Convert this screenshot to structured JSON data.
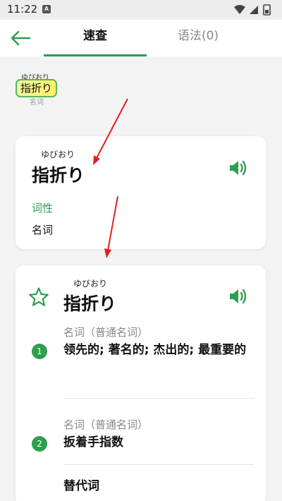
{
  "status_bar": {
    "time": "11:22",
    "notification_badge": "A"
  },
  "nav": {
    "back_icon": "arrow-left-icon",
    "tabs": [
      {
        "label": "速查",
        "active": true
      },
      {
        "label": "语法(0)",
        "active": false
      }
    ],
    "accent_color": "#2e9e4f"
  },
  "chip": {
    "ruby": "ゆびおり",
    "word": "指折り",
    "pos": "名词"
  },
  "summary_card": {
    "ruby": "ゆびおり",
    "word": "指折り",
    "part_of_speech_label": "词性",
    "part_of_speech": "名词",
    "speaker_icon": "speaker-icon"
  },
  "detail_card": {
    "ruby": "ゆびおり",
    "word": "指折り",
    "star_icon": "star-outline-icon",
    "speaker_icon": "speaker-icon",
    "senses": [
      {
        "number": "1",
        "pos": "名词（普通名词）",
        "definition": "领先的; 著名的; 杰出的; 最重要的"
      },
      {
        "number": "2",
        "pos": "名词（普通名词）",
        "definition": "扳着手指数"
      }
    ],
    "section_title": "替代词"
  }
}
